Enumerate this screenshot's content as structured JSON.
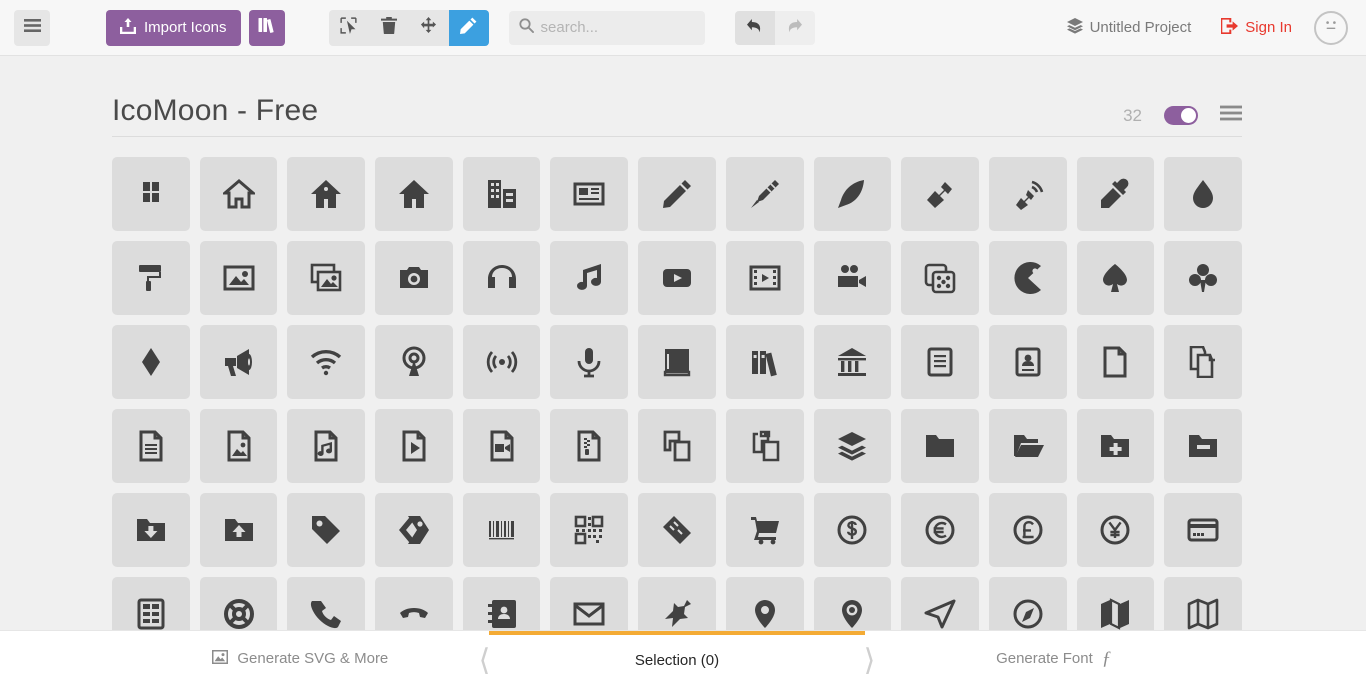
{
  "header": {
    "menu_icon": "hamburger-icon",
    "import_label": "Import Icons",
    "import_icon": "upload-icon",
    "library_icon": "books-icon",
    "tools": [
      {
        "name": "select",
        "icon": "cursor-select-icon",
        "active": false
      },
      {
        "name": "delete",
        "icon": "trash-icon",
        "active": false
      },
      {
        "name": "move",
        "icon": "move-arrows-icon",
        "active": false
      },
      {
        "name": "edit",
        "icon": "pencil-icon",
        "active": true
      }
    ],
    "search": {
      "placeholder": "search...",
      "value": "",
      "icon": "search-icon"
    },
    "undo": {
      "icon": "undo-arrow-icon",
      "enabled": true
    },
    "redo": {
      "icon": "redo-arrow-icon",
      "enabled": false
    },
    "project_label": "Untitled Project",
    "project_icon": "stack-layers-icon",
    "signin_label": "Sign In",
    "signin_icon": "enter-door-icon",
    "account_icon": "neutral-face-icon",
    "accent_purple": "#8d5f9e",
    "accent_blue": "#3ca0e0",
    "accent_red": "#e8392e"
  },
  "set": {
    "title": "IcoMoon - Free",
    "count": "32",
    "toggle_on": true,
    "toggle_color": "#8d5f9e",
    "menu_icon": "list-menu-icon"
  },
  "icons": [
    "icomoon-logo",
    "home",
    "home2",
    "home3",
    "office",
    "newspaper",
    "pencil",
    "pencil2",
    "quill",
    "pen",
    "blog",
    "eyedropper",
    "droplet",
    "paint-format",
    "image",
    "images",
    "camera",
    "headphones",
    "music",
    "play",
    "film",
    "video-camera",
    "dice",
    "pacman",
    "spades",
    "clubs",
    "diamonds",
    "bullhorn",
    "connection",
    "podcast",
    "feed",
    "mic",
    "book",
    "books",
    "library",
    "file-text",
    "profile",
    "file-empty",
    "files-empty",
    "file-text2",
    "file-picture",
    "file-music",
    "file-play",
    "file-video",
    "file-zip",
    "copy",
    "paste",
    "stack",
    "folder",
    "folder-open",
    "folder-plus",
    "folder-minus",
    "folder-download",
    "folder-upload",
    "price-tag",
    "price-tags",
    "barcode",
    "qrcode",
    "ticket",
    "cart",
    "coin-dollar",
    "coin-euro",
    "coin-pound",
    "coin-yen",
    "credit-card",
    "calculator",
    "lifebuoy",
    "phone",
    "phone-hang-up",
    "address-book",
    "envelop",
    "pushpin",
    "location",
    "location2",
    "compass",
    "compass2",
    "map",
    "map2"
  ],
  "bottombar": {
    "left_label": "Generate SVG & More",
    "left_icon": "image-icon",
    "center_label": "Selection (0)",
    "right_label": "Generate Font",
    "right_icon": "font-f-icon",
    "active_color": "#f4ab35"
  }
}
